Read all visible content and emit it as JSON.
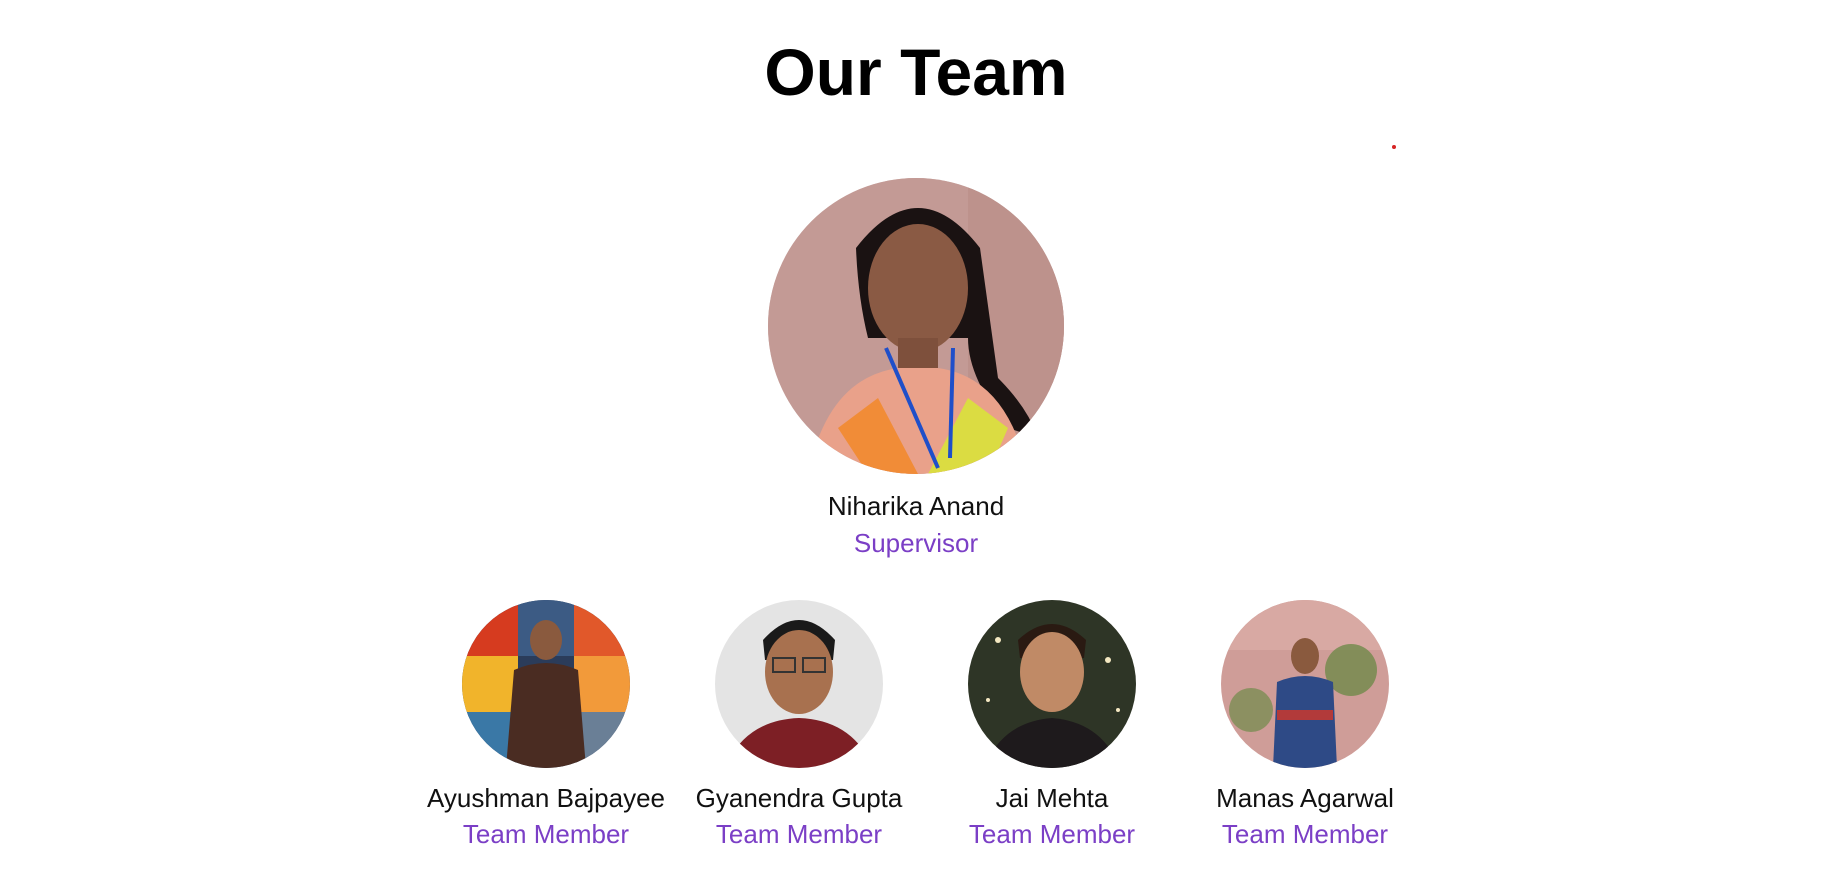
{
  "header": {
    "title": "Our Team"
  },
  "supervisor": {
    "name": "Niharika Anand",
    "role": "Supervisor",
    "photo_icon": "person-photo"
  },
  "members": [
    {
      "name": "Ayushman Bajpayee",
      "role": "Team Member",
      "photo_icon": "person-photo"
    },
    {
      "name": "Gyanendra Gupta",
      "role": "Team Member",
      "photo_icon": "person-photo"
    },
    {
      "name": "Jai Mehta",
      "role": "Team Member",
      "photo_icon": "person-photo"
    },
    {
      "name": "Manas Agarwal",
      "role": "Team Member",
      "photo_icon": "person-photo"
    }
  ],
  "colors": {
    "title": "#000000",
    "name": "#111111",
    "role": "#7b3fc6",
    "accent_dot": "#d62424"
  }
}
